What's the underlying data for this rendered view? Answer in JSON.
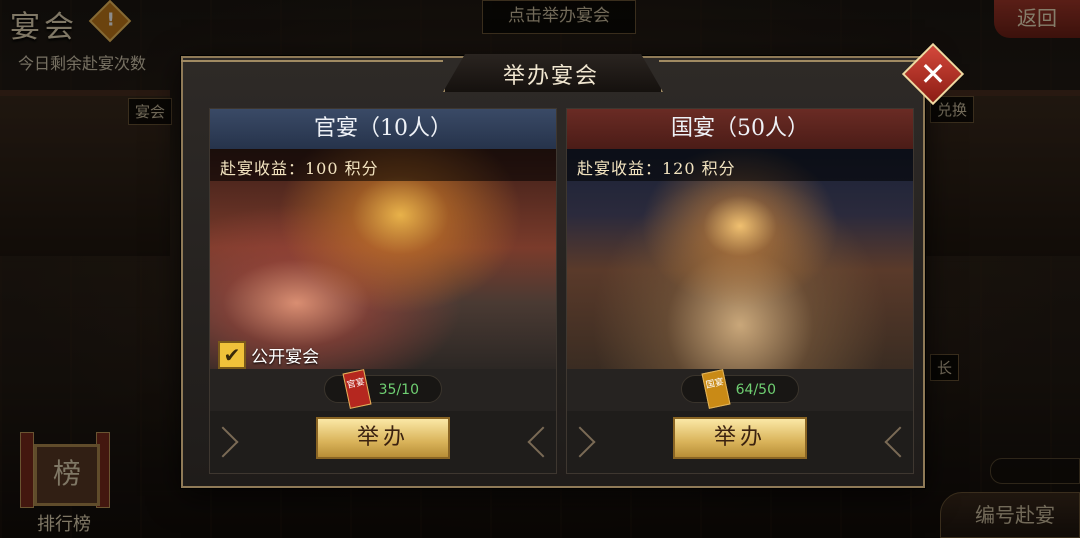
{
  "app": {
    "title": "宴会",
    "warn_glyph": "!",
    "top_hint": "点击举办宴会",
    "back_label": "返回",
    "remaining_text": "今日剩余赴宴次数",
    "side_tag_left": "宴会",
    "side_tag_right": "兑换",
    "side_tag_right2": "长",
    "rank_board": "榜",
    "rank_label": "排行榜",
    "number_button": "编号赴宴"
  },
  "dialog": {
    "title": "举办宴会",
    "close_glyph": "✕",
    "cards": [
      {
        "name": "官宴（10人）",
        "income": "赴宴收益：100 积分",
        "public_label": "公开宴会",
        "public_checked": true,
        "check_glyph": "✔",
        "invite_text": "官宴",
        "count": "35/10",
        "count_color": "#6fcf72",
        "button": "举办",
        "header_color": "#33425c"
      },
      {
        "name": "国宴（50人）",
        "income": "赴宴收益：120 积分",
        "invite_text": "国宴",
        "count": "64/50",
        "count_color": "#6fcf72",
        "button": "举办",
        "header_color": "#5b241e"
      }
    ]
  }
}
